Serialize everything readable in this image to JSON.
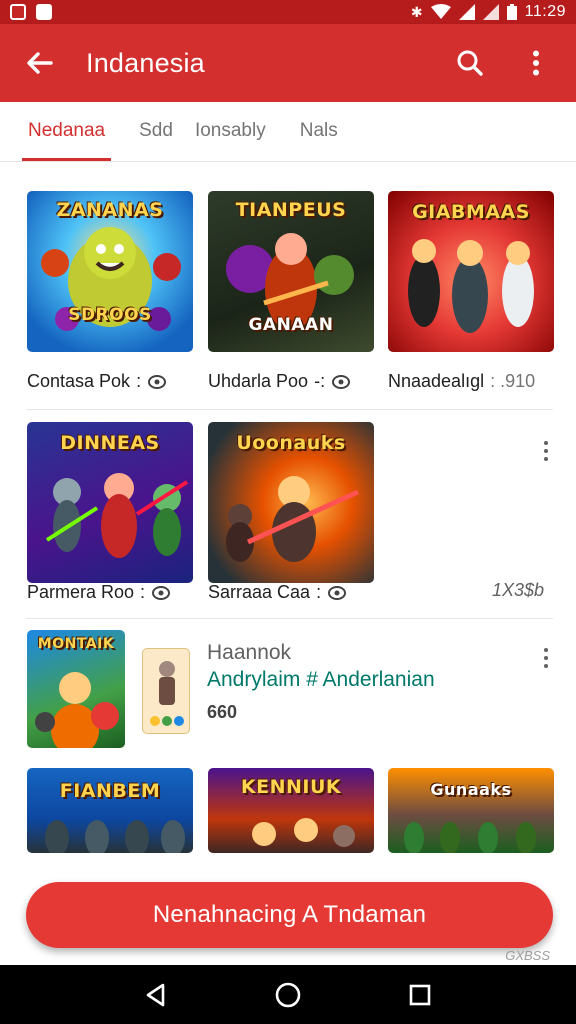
{
  "status_bar": {
    "time": "11:29"
  },
  "app_bar": {
    "title": "Indanesia",
    "icons": {
      "back": "arrow-left-icon",
      "search": "search-icon",
      "more": "more-vert-icon"
    }
  },
  "tabs": [
    {
      "label": "Nedanaa",
      "active": true
    },
    {
      "label": "Sdd",
      "active": false
    },
    {
      "label": "Ionsably",
      "active": false
    },
    {
      "label": "Nals",
      "active": false
    }
  ],
  "row1": [
    {
      "thumb_title": "ZANANAS",
      "thumb_sub": "SDROOS",
      "caption": "Contasa Pok",
      "extra": ":"
    },
    {
      "thumb_title": "TIANPEUS",
      "thumb_sub": "GANAAN",
      "caption": "Uhdarla Poo",
      "extra": "-:"
    },
    {
      "thumb_title": "GIABMAAS",
      "thumb_sub": "",
      "caption": "Nnaadealıgl",
      "extra": ": .910"
    }
  ],
  "row2": [
    {
      "thumb_title": "DINNEAS",
      "caption": "Parmera Roo",
      "extra": ":"
    },
    {
      "thumb_title": "Uoonauks",
      "caption": "Sarraaa Caa",
      "extra": ":"
    }
  ],
  "row2_value": "1X3$b",
  "featured": {
    "thumb_title": "MONTAIK",
    "title": "Haannok",
    "subtitle": "Andrylaim # Anderlanian",
    "meta": "660"
  },
  "row4": [
    {
      "thumb_title": "FIANBEM"
    },
    {
      "thumb_title": "KENNIUK"
    },
    {
      "thumb_title": "Gunaaks"
    }
  ],
  "cta": {
    "label": "Nenahnacing A Tndaman"
  },
  "watermark": "GXBSS",
  "colors": {
    "primary": "#d32f2f",
    "status": "#b71c1c",
    "accent_teal": "#00796b"
  }
}
